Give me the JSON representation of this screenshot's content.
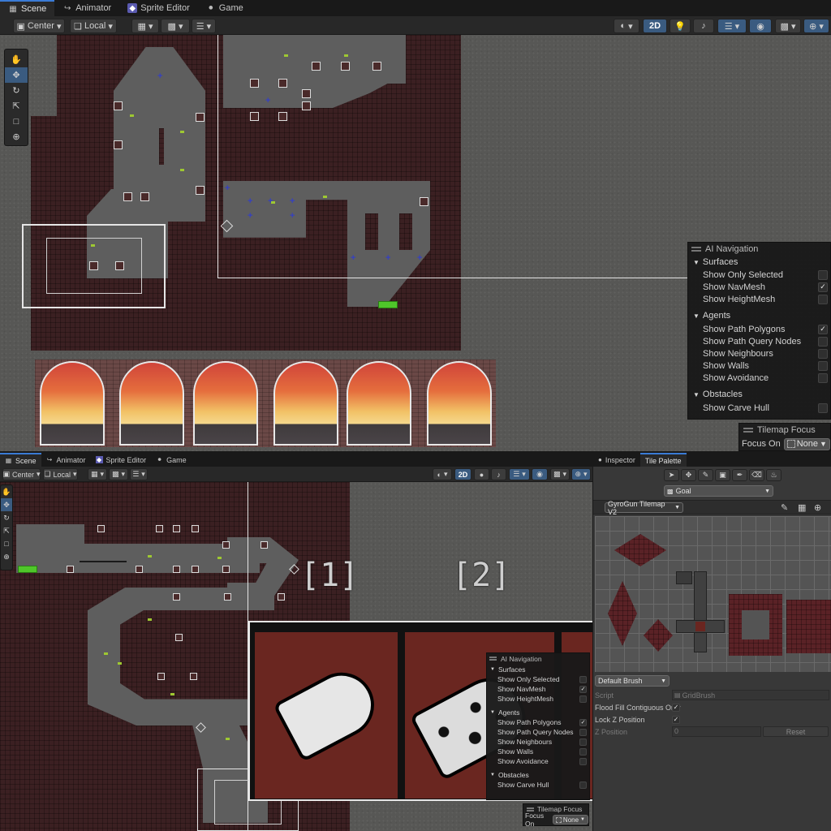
{
  "top": {
    "tabs": [
      {
        "label": "Scene",
        "icon": "scene-icon"
      },
      {
        "label": "Animator",
        "icon": "animator-icon"
      },
      {
        "label": "Sprite Editor",
        "icon": "sprite-editor-icon"
      },
      {
        "label": "Game",
        "icon": "game-icon"
      }
    ],
    "toolbar": {
      "pivot": "Center",
      "space": "Local",
      "mode_2d": "2D"
    },
    "ai_navigation": {
      "title": "AI Navigation",
      "surfaces": {
        "label": "Surfaces",
        "items": [
          {
            "label": "Show Only Selected",
            "checked": false
          },
          {
            "label": "Show NavMesh",
            "checked": true
          },
          {
            "label": "Show HeightMesh",
            "checked": false
          }
        ]
      },
      "agents": {
        "label": "Agents",
        "items": [
          {
            "label": "Show Path Polygons",
            "checked": true
          },
          {
            "label": "Show Path Query Nodes",
            "checked": false
          },
          {
            "label": "Show Neighbours",
            "checked": false
          },
          {
            "label": "Show Walls",
            "checked": false
          },
          {
            "label": "Show Avoidance",
            "checked": false
          }
        ]
      },
      "obstacles": {
        "label": "Obstacles",
        "items": [
          {
            "label": "Show Carve Hull",
            "checked": false
          }
        ]
      }
    },
    "tilemap_focus": {
      "title": "Tilemap Focus",
      "focus_label": "Focus On",
      "value": "None"
    }
  },
  "bottom": {
    "tabs": [
      {
        "label": "Scene",
        "icon": "scene-icon"
      },
      {
        "label": "Animator",
        "icon": "animator-icon"
      },
      {
        "label": "Sprite Editor",
        "icon": "sprite-editor-icon"
      },
      {
        "label": "Game",
        "icon": "game-icon"
      }
    ],
    "toolbar": {
      "pivot": "Center",
      "space": "Local",
      "mode_2d": "2D"
    },
    "labels": {
      "one": "[1]",
      "two": "[2]"
    },
    "ai_navigation": {
      "title": "AI Navigation",
      "surfaces": {
        "label": "Surfaces",
        "items": [
          {
            "label": "Show Only Selected",
            "checked": false
          },
          {
            "label": "Show NavMesh",
            "checked": true
          },
          {
            "label": "Show HeightMesh",
            "checked": false
          }
        ]
      },
      "agents": {
        "label": "Agents",
        "items": [
          {
            "label": "Show Path Polygons",
            "checked": true
          },
          {
            "label": "Show Path Query Nodes",
            "checked": false
          },
          {
            "label": "Show Neighbours",
            "checked": false
          },
          {
            "label": "Show Walls",
            "checked": false
          },
          {
            "label": "Show Avoidance",
            "checked": false
          }
        ]
      },
      "obstacles": {
        "label": "Obstacles",
        "items": [
          {
            "label": "Show Carve Hull",
            "checked": false
          }
        ]
      }
    },
    "tilemap_focus": {
      "title": "Tilemap Focus",
      "focus_label": "Focus On",
      "value": "None"
    }
  },
  "inspector": {
    "tabs": [
      {
        "label": "Inspector",
        "icon": "info-icon"
      },
      {
        "label": "Tile Palette"
      }
    ],
    "palette_target": "Goal",
    "palette_name": "GyroGun Tilemap V2",
    "brush": "Default Brush",
    "script_label": "Script",
    "script_value": "GridBrush",
    "flood_label": "Flood Fill Contiguous Only",
    "flood_checked": true,
    "lockz_label": "Lock Z Position",
    "lockz_checked": true,
    "zpos_label": "Z Position",
    "zpos_value": "0",
    "reset_label": "Reset"
  }
}
